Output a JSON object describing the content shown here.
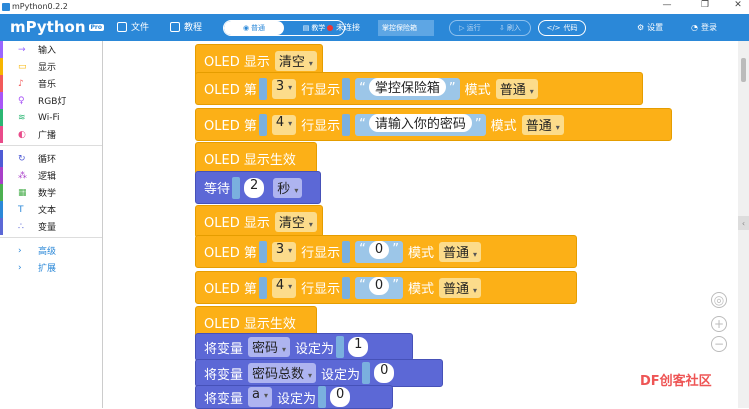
{
  "window": {
    "title": "mPython0.2.2",
    "min": "—",
    "max": "❐",
    "close": "✕"
  },
  "toolbar": {
    "logo": "mPython",
    "logo_badge": "Pro",
    "file": "文件",
    "tutorial": "教程",
    "mode_normal": "普通",
    "mode_teach": "教学",
    "status": "未连接",
    "filename": "掌控保险箱",
    "run": "运行",
    "flash": "刷入",
    "code": "代码",
    "settings": "设置",
    "login": "登录"
  },
  "sidebar": {
    "items": [
      {
        "label": "输入",
        "color": "#9966ff",
        "icon": "→"
      },
      {
        "label": "显示",
        "color": "#f7b500",
        "icon": "▭"
      },
      {
        "label": "音乐",
        "color": "#f25a5a",
        "icon": "♪"
      },
      {
        "label": "RGB灯",
        "color": "#a855f7",
        "icon": "♀"
      },
      {
        "label": "Wi-Fi",
        "color": "#2bb673",
        "icon": "≋"
      },
      {
        "label": "广播",
        "color": "#e94b8a",
        "icon": "◐"
      },
      {
        "label": "循环",
        "color": "#4f5bd5",
        "icon": "↻"
      },
      {
        "label": "逻辑",
        "color": "#a83fc8",
        "icon": "⁂"
      },
      {
        "label": "数学",
        "color": "#4caf50",
        "icon": "▦"
      },
      {
        "label": "文本",
        "color": "#2b88d8",
        "icon": "T"
      },
      {
        "label": "变量",
        "color": "#5c68d6",
        "icon": "∴"
      }
    ],
    "advanced": "高级",
    "extend": "扩展"
  },
  "blocks": {
    "oled_show": "OLED 显示",
    "clear": "清空",
    "oled_line": "OLED 第",
    "line_show": "行显示",
    "mode": "模式",
    "normal": "普通",
    "l3": "3",
    "l4": "4",
    "s1": "掌控保险箱",
    "s2": "请输入你的密码",
    "s0": "0",
    "s0b": "0",
    "q_open": "“",
    "q_close": "”",
    "commit": "OLED 显示生效",
    "wait": "等待",
    "wait_n": "2",
    "sec": "秒",
    "setvar": "将变量",
    "setto": "设定为",
    "v1": "密码",
    "v1n": "1",
    "v2": "密码总数",
    "v2n": "0",
    "v3": "a",
    "v3n": "0"
  },
  "watermark": "DF创客社区"
}
